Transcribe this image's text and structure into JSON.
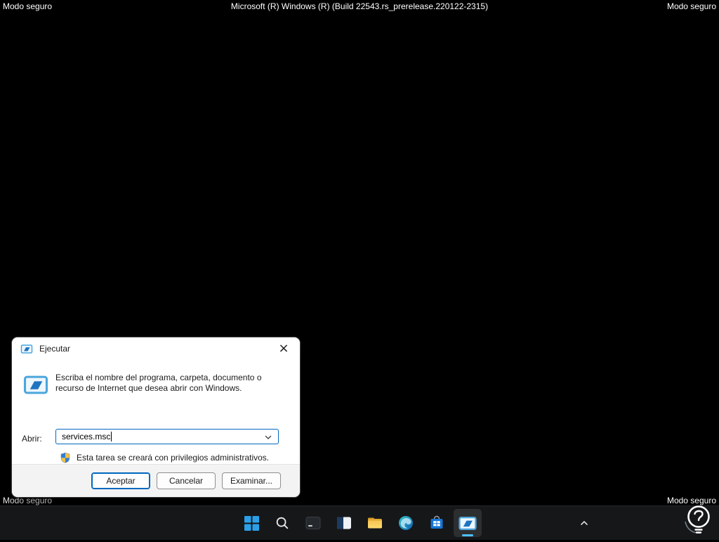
{
  "screen": {
    "safe_mode_label": "Modo seguro",
    "build_label": "Microsoft (R) Windows (R) (Build 22543.rs_prerelease.220122-2315)"
  },
  "dialog": {
    "title": "Ejecutar",
    "close_glyph": "×",
    "description": "Escriba el nombre del programa, carpeta, documento o recurso de Internet que desea abrir con Windows.",
    "open_label": "Abrir:",
    "input_value": "services.msc",
    "admin_note": "Esta tarea se creará con privilegios administrativos.",
    "buttons": {
      "ok": "Aceptar",
      "cancel": "Cancelar",
      "browse": "Examinar..."
    }
  },
  "taskbar": {
    "icons": [
      {
        "name": "start"
      },
      {
        "name": "search"
      },
      {
        "name": "dark-window-app"
      },
      {
        "name": "task-view"
      },
      {
        "name": "file-explorer"
      },
      {
        "name": "edge"
      },
      {
        "name": "store"
      },
      {
        "name": "run-app",
        "active": true
      }
    ]
  },
  "colors": {
    "accent": "#0067c0",
    "taskbar_indicator": "#4cc2ff",
    "taskbar_bg": "#161719"
  }
}
